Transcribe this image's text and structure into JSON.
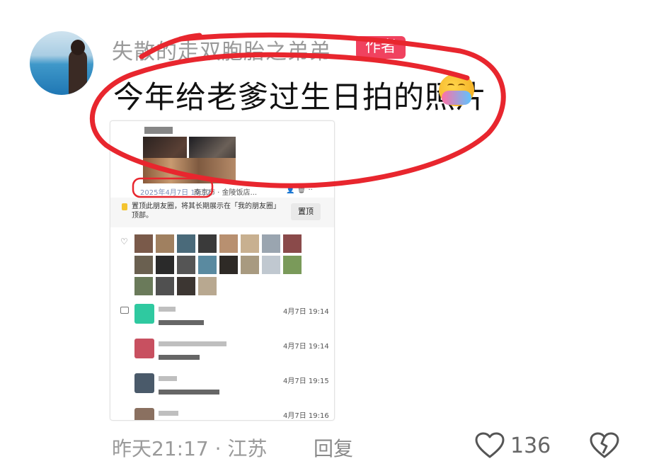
{
  "comment": {
    "username": "失散的走双胞胎之弟弟",
    "author_badge": "作者",
    "text": "今年给老爹过生日拍的照片",
    "emoji_name": "hugging-face-emoji",
    "timestamp": "昨天21:17 · 江苏",
    "reply_label": "回复",
    "like_count": "136"
  },
  "screenshot": {
    "post_date": "2025年4月7日 19:12",
    "location": "南京市 · 金陵饭店...",
    "pin_text": "置顶此朋友圈，将其长期展示在「我的朋友圈」顶部。",
    "pin_button": "置顶",
    "comment_times": [
      "4月7日 19:14",
      "4月7日 19:14",
      "4月7日 19:15",
      "4月7日 19:16"
    ]
  },
  "colors": {
    "badge": "#f0425f",
    "annotation": "#e8262e",
    "muted_text": "#9a9a9a"
  }
}
